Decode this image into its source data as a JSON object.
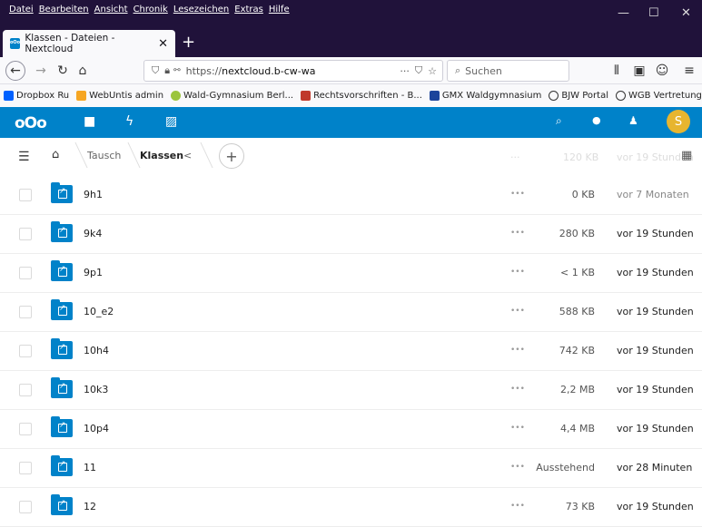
{
  "browser": {
    "menu": [
      "Datei",
      "Bearbeiten",
      "Ansicht",
      "Chronik",
      "Lesezeichen",
      "Extras",
      "Hilfe"
    ],
    "tab_title": "Klassen - Dateien - Nextcloud",
    "url_prefix": "https://",
    "url_host": "nextcloud.b-cw-wa",
    "search_placeholder": "Suchen",
    "bookmarks": [
      "Dropbox Ru",
      "WebUntis admin",
      "Wald-Gymnasium Berl...",
      "Rechtsvorschriften - B...",
      "GMX Waldgymnasium",
      "BJW Portal",
      "WGB Vertretung"
    ]
  },
  "nextcloud": {
    "avatar_initial": "S",
    "breadcrumb": [
      "Tausch",
      "Klassen"
    ],
    "ghost_size": "120 KB",
    "ghost_date": "vor 19 Stunden"
  },
  "files": [
    {
      "name": "9h1",
      "size": "0 KB",
      "date": "vor 7 Monaten",
      "muted": true
    },
    {
      "name": "9k4",
      "size": "280 KB",
      "date": "vor 19 Stunden",
      "muted": false
    },
    {
      "name": "9p1",
      "size": "< 1 KB",
      "date": "vor 19 Stunden",
      "muted": false
    },
    {
      "name": "10_e2",
      "size": "588 KB",
      "date": "vor 19 Stunden",
      "muted": false
    },
    {
      "name": "10h4",
      "size": "742 KB",
      "date": "vor 19 Stunden",
      "muted": false
    },
    {
      "name": "10k3",
      "size": "2,2 MB",
      "date": "vor 19 Stunden",
      "muted": false
    },
    {
      "name": "10p4",
      "size": "4,4 MB",
      "date": "vor 19 Stunden",
      "muted": false
    },
    {
      "name": "11",
      "size": "Ausstehend",
      "date": "vor 28 Minuten",
      "muted": false
    },
    {
      "name": "12",
      "size": "73 KB",
      "date": "vor 19 Stunden",
      "muted": false
    }
  ],
  "colors": {
    "nextcloud_blue": "#0082c9",
    "firefox_dark": "#20123a",
    "avatar": "#e7b52f"
  }
}
